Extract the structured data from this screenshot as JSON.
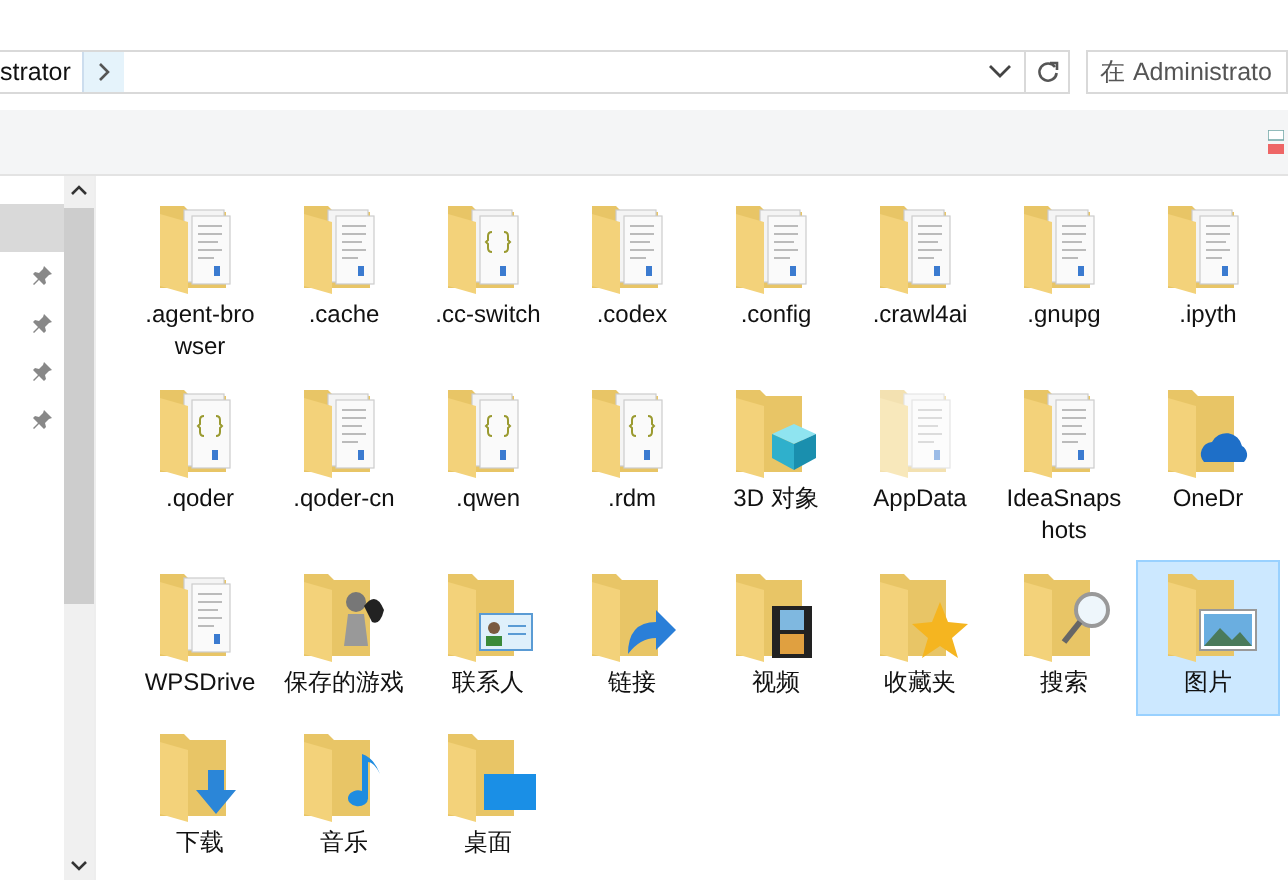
{
  "address_bar": {
    "breadcrumb": "strator"
  },
  "search": {
    "placeholder": "在 Administrato"
  },
  "nav_pane": {
    "items": [
      {
        "selected": true,
        "pinned": false
      },
      {
        "selected": false,
        "pinned": true
      },
      {
        "selected": false,
        "pinned": true
      },
      {
        "selected": false,
        "pinned": true
      },
      {
        "selected": false,
        "pinned": true
      }
    ]
  },
  "files": [
    {
      "name": ".agent-browser",
      "kind": "doc",
      "hidden": false,
      "selected": false
    },
    {
      "name": ".cache",
      "kind": "doc",
      "hidden": false,
      "selected": false
    },
    {
      "name": ".cc-switch",
      "kind": "code",
      "hidden": false,
      "selected": false
    },
    {
      "name": ".codex",
      "kind": "doc",
      "hidden": false,
      "selected": false
    },
    {
      "name": ".config",
      "kind": "doc",
      "hidden": false,
      "selected": false
    },
    {
      "name": ".crawl4ai",
      "kind": "doc",
      "hidden": false,
      "selected": false
    },
    {
      "name": ".gnupg",
      "kind": "doc",
      "hidden": false,
      "selected": false
    },
    {
      "name": ".ipyth",
      "kind": "doc",
      "hidden": false,
      "selected": false
    },
    {
      "name": ".qoder",
      "kind": "code",
      "hidden": false,
      "selected": false
    },
    {
      "name": ".qoder-cn",
      "kind": "doc",
      "hidden": false,
      "selected": false
    },
    {
      "name": ".qwen",
      "kind": "code",
      "hidden": false,
      "selected": false
    },
    {
      "name": ".rdm",
      "kind": "code",
      "hidden": false,
      "selected": false
    },
    {
      "name": "3D 对象",
      "kind": "cube",
      "hidden": false,
      "selected": false
    },
    {
      "name": "AppData",
      "kind": "doc",
      "hidden": true,
      "selected": false
    },
    {
      "name": "IdeaSnapshots",
      "kind": "doc",
      "hidden": false,
      "selected": false
    },
    {
      "name": "OneDr",
      "kind": "cloud",
      "hidden": false,
      "selected": false
    },
    {
      "name": "WPSDrive",
      "kind": "doc",
      "hidden": false,
      "selected": false
    },
    {
      "name": "保存的游戏",
      "kind": "chess",
      "hidden": false,
      "selected": false
    },
    {
      "name": "联系人",
      "kind": "contact",
      "hidden": false,
      "selected": false
    },
    {
      "name": "链接",
      "kind": "link",
      "hidden": false,
      "selected": false
    },
    {
      "name": "视频",
      "kind": "video",
      "hidden": false,
      "selected": false
    },
    {
      "name": "收藏夹",
      "kind": "star",
      "hidden": false,
      "selected": false
    },
    {
      "name": "搜索",
      "kind": "search",
      "hidden": false,
      "selected": false
    },
    {
      "name": "图片",
      "kind": "picture",
      "hidden": false,
      "selected": true
    },
    {
      "name": "下载",
      "kind": "download",
      "hidden": false,
      "selected": false
    },
    {
      "name": "音乐",
      "kind": "music",
      "hidden": false,
      "selected": false
    },
    {
      "name": "桌面",
      "kind": "desktop",
      "hidden": false,
      "selected": false
    }
  ]
}
